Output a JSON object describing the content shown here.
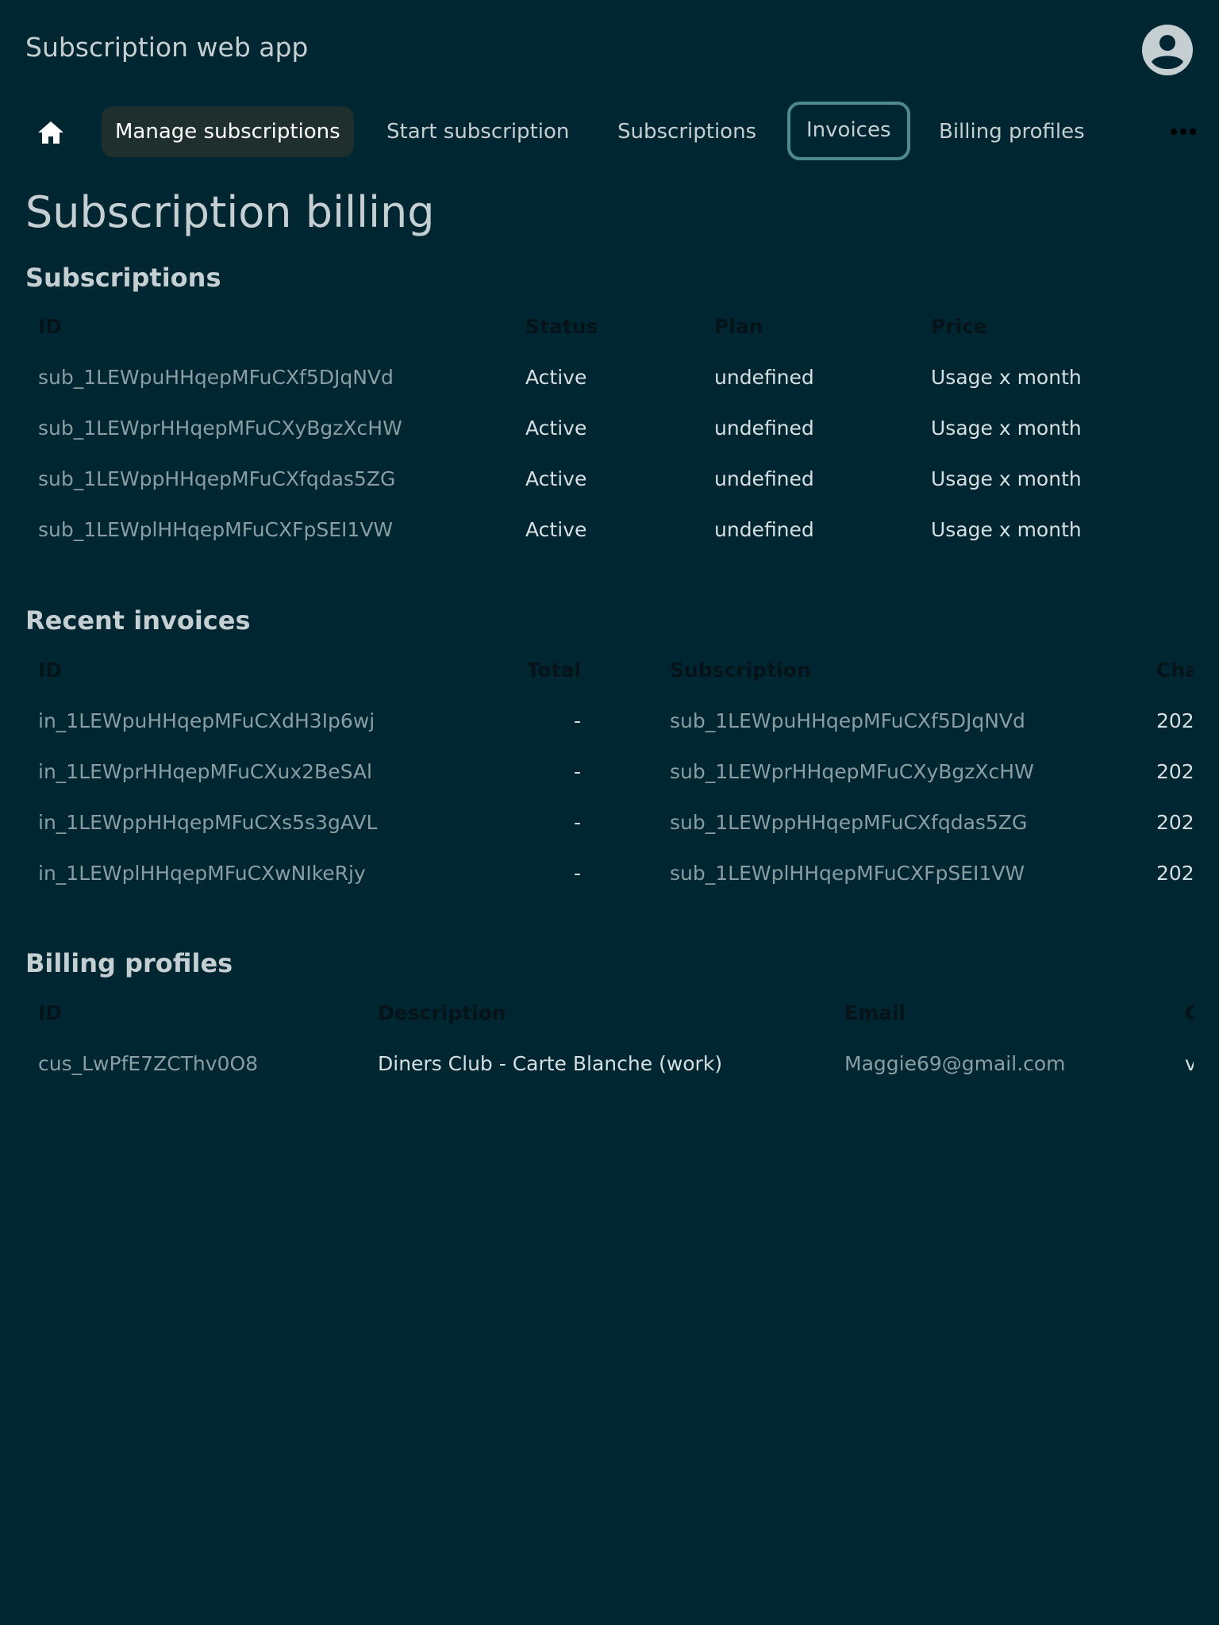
{
  "app": {
    "title": "Subscription web app"
  },
  "nav": {
    "items": [
      {
        "label": "Manage subscriptions"
      },
      {
        "label": "Start subscription"
      },
      {
        "label": "Subscriptions"
      },
      {
        "label": "Invoices"
      },
      {
        "label": "Billing profiles"
      }
    ]
  },
  "page": {
    "title": "Subscription billing"
  },
  "subscriptions": {
    "title": "Subscriptions",
    "columns": [
      "ID",
      "Status",
      "Plan",
      "Price"
    ],
    "rows": [
      {
        "id": "sub_1LEWpuHHqepMFuCXf5DJqNVd",
        "status": "Active",
        "plan": "undefined",
        "price": "Usage x month"
      },
      {
        "id": "sub_1LEWprHHqepMFuCXyBgzXcHW",
        "status": "Active",
        "plan": "undefined",
        "price": "Usage x month"
      },
      {
        "id": "sub_1LEWppHHqepMFuCXfqdas5ZG",
        "status": "Active",
        "plan": "undefined",
        "price": "Usage x month"
      },
      {
        "id": "sub_1LEWplHHqepMFuCXFpSEI1VW",
        "status": "Active",
        "plan": "undefined",
        "price": "Usage x month"
      }
    ]
  },
  "invoices": {
    "title": "Recent invoices",
    "columns": [
      "ID",
      "Total",
      "Subscription",
      "Cha"
    ],
    "rows": [
      {
        "id": "in_1LEWpuHHqepMFuCXdH3Ip6wj",
        "total": "-",
        "subscription": "sub_1LEWpuHHqepMFuCXf5DJqNVd",
        "charge": "202"
      },
      {
        "id": "in_1LEWprHHqepMFuCXux2BeSAl",
        "total": "-",
        "subscription": "sub_1LEWprHHqepMFuCXyBgzXcHW",
        "charge": "202"
      },
      {
        "id": "in_1LEWppHHqepMFuCXs5s3gAVL",
        "total": "-",
        "subscription": "sub_1LEWppHHqepMFuCXfqdas5ZG",
        "charge": "202"
      },
      {
        "id": "in_1LEWplHHqepMFuCXwNIkeRjy",
        "total": "-",
        "subscription": "sub_1LEWplHHqepMFuCXFpSEI1VW",
        "charge": "202"
      }
    ]
  },
  "billing_profiles": {
    "title": "Billing profiles",
    "columns": [
      "ID",
      "Description",
      "Email",
      "C"
    ],
    "rows": [
      {
        "id": "cus_LwPfE7ZCThv0O8",
        "description": "Diners Club - Carte Blanche (work)",
        "email": "Maggie69@gmail.com",
        "extra": "v"
      }
    ]
  },
  "icons": {
    "home": "home-icon",
    "avatar": "account-circle-icon",
    "more": "more-horizontal-icon"
  },
  "colors": {
    "background": "#002632",
    "nav_selected_bg": "#1f2f2e",
    "focus_ring": "#4e8a8b",
    "text": "#c5cfd2",
    "muted_text": "#8a9da3",
    "header_text": "#06141a"
  }
}
